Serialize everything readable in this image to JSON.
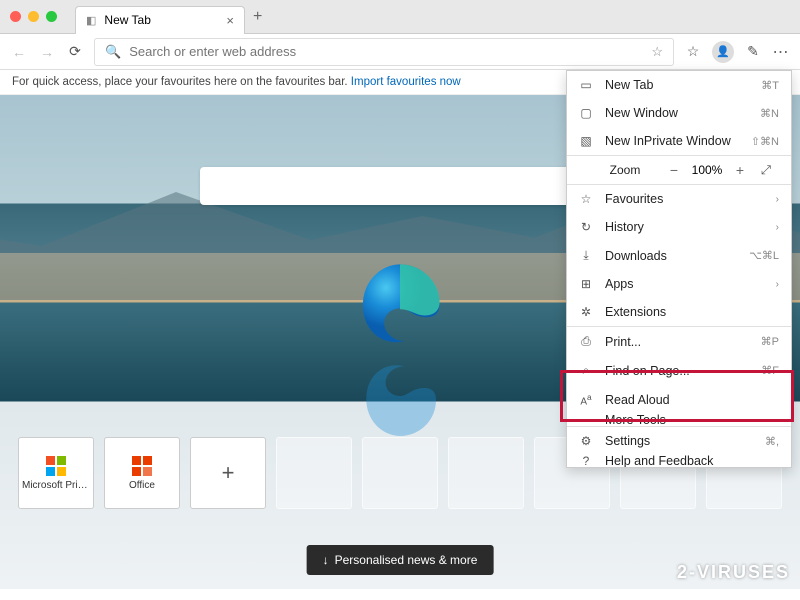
{
  "titlebar": {
    "tab_title": "New Tab"
  },
  "toolbar": {
    "placeholder": "Search or enter web address"
  },
  "favbar": {
    "text": "For quick access, place your favourites here on the favourites bar.",
    "link": "Import favourites now"
  },
  "search": {
    "placeholder": ""
  },
  "tiles": [
    {
      "label": "Microsoft Priv...",
      "type": "ms"
    },
    {
      "label": "Office",
      "type": "office"
    }
  ],
  "news_button": "Personalised news & more",
  "watermark": "2-VIRUSES",
  "menu": {
    "items": [
      {
        "icon": "▭",
        "label": "New Tab",
        "kbd": "⌘T"
      },
      {
        "icon": "▢",
        "label": "New Window",
        "kbd": "⌘N"
      },
      {
        "icon": "▧",
        "label": "New InPrivate Window",
        "kbd": "⇧⌘N"
      }
    ],
    "zoom_label": "Zoom",
    "zoom_value": "100%",
    "items2": [
      {
        "icon": "☆",
        "label": "Favourites",
        "arrow": true
      },
      {
        "icon": "↻",
        "label": "History",
        "arrow": true
      },
      {
        "icon": "⤓",
        "label": "Downloads",
        "kbd": "⌥⌘L"
      },
      {
        "icon": "⊞",
        "label": "Apps",
        "arrow": true
      },
      {
        "icon": "✲",
        "label": "Extensions"
      }
    ],
    "items3": [
      {
        "icon": "⎙",
        "label": "Print...",
        "kbd": "⌘P"
      },
      {
        "icon": "⌕",
        "label": "Find on Page...",
        "kbd": "⌘F"
      },
      {
        "icon": "Aᵃ",
        "label": "Read Aloud"
      },
      {
        "icon": "",
        "label": "More Tools",
        "arrow": true,
        "clipped": true
      }
    ],
    "items4": [
      {
        "icon": "⚙",
        "label": "Settings",
        "kbd": "⌘,"
      },
      {
        "icon": "?",
        "label": "Help and Feedback",
        "arrow": true,
        "clipped": true
      }
    ]
  }
}
